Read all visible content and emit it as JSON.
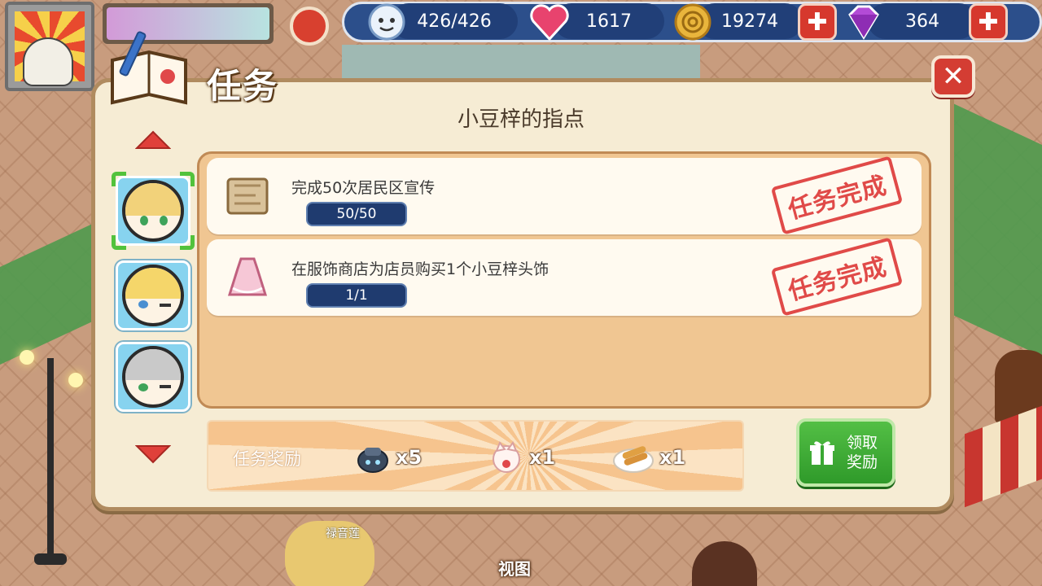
{
  "hud": {
    "stamina": "426/426",
    "hearts": "1617",
    "coins": "19274",
    "gems": "364",
    "plus": "✚"
  },
  "quest_window": {
    "heading": "任务",
    "title": "小豆梓的指点",
    "close_label": "✕",
    "tasks": [
      {
        "text": "完成50次居民区宣传",
        "progress": "50/50",
        "status": "任务完成"
      },
      {
        "text": "在服饰商店为店员购买1个小豆梓头饰",
        "progress": "1/1",
        "status": "任务完成"
      }
    ],
    "reward": {
      "label": "任务奖励",
      "items": [
        {
          "icon": "robot-pot-icon",
          "qty": "x5"
        },
        {
          "icon": "lucky-cat-icon",
          "qty": "x1"
        },
        {
          "icon": "fried-shrimp-icon",
          "qty": "x1"
        }
      ]
    },
    "claim_button": {
      "line1": "领取",
      "line2": "奖励"
    }
  },
  "scene": {
    "view_label": "视图",
    "npc_name": "禄音莲"
  },
  "colors": {
    "dialog_bg": "#f6ecd4",
    "panel_bg": "#f0c692",
    "stamp_red": "#e04a48",
    "claim_green": "#3aa833",
    "hud_blue": "#2c4f8b"
  }
}
